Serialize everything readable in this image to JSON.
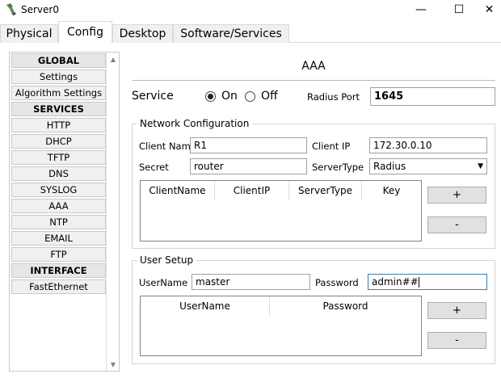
{
  "window": {
    "title": "Server0",
    "minimize": "—",
    "maximize": "☐",
    "close": "✕"
  },
  "tabs": [
    {
      "label": "Physical"
    },
    {
      "label": "Config"
    },
    {
      "label": "Desktop"
    },
    {
      "label": "Software/Services"
    }
  ],
  "sidebar": {
    "items": [
      {
        "label": "GLOBAL",
        "header": true
      },
      {
        "label": "Settings"
      },
      {
        "label": "Algorithm Settings"
      },
      {
        "label": "SERVICES",
        "header": true
      },
      {
        "label": "HTTP"
      },
      {
        "label": "DHCP"
      },
      {
        "label": "TFTP"
      },
      {
        "label": "DNS"
      },
      {
        "label": "SYSLOG"
      },
      {
        "label": "AAA"
      },
      {
        "label": "NTP"
      },
      {
        "label": "EMAIL"
      },
      {
        "label": "FTP"
      },
      {
        "label": "INTERFACE",
        "header": true
      },
      {
        "label": "FastEthernet"
      }
    ]
  },
  "aaa": {
    "title": "AAA",
    "service_label": "Service",
    "on_label": "On",
    "off_label": "Off",
    "service_state": "On",
    "radius_port_label": "Radius Port",
    "radius_port_value": "1645",
    "network": {
      "title": "Network Configuration",
      "client_name_label": "Client Name",
      "client_name_value": "R1",
      "client_ip_label": "Client IP",
      "client_ip_value": "172.30.0.10",
      "secret_label": "Secret",
      "secret_value": "router",
      "server_type_label": "ServerType",
      "server_type_value": "Radius",
      "columns": [
        "ClientName",
        "ClientIP",
        "ServerType",
        "Key"
      ],
      "add_label": "+",
      "remove_label": "-"
    },
    "user_setup": {
      "title": "User Setup",
      "username_label": "UserName",
      "username_value": "master",
      "password_label": "Password",
      "password_value": "admin##",
      "columns": [
        "UserName",
        "Password"
      ],
      "add_label": "+",
      "remove_label": "-"
    }
  }
}
